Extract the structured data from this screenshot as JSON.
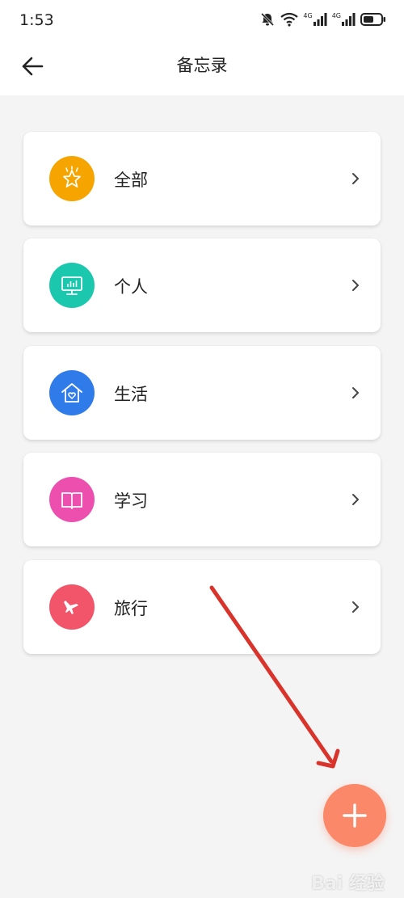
{
  "status_bar": {
    "time": "1:53",
    "signal_label_1": "4G",
    "signal_label_2": "4G",
    "icons": [
      "mute-bell-icon",
      "wifi-icon",
      "signal-icon",
      "signal-icon",
      "battery-icon"
    ]
  },
  "header": {
    "title": "备忘录",
    "back_icon": "arrow-left-icon"
  },
  "categories": [
    {
      "label": "全部",
      "icon": "star-icon",
      "color": "#f5a400"
    },
    {
      "label": "个人",
      "icon": "monitor-icon",
      "color": "#1cc8ad"
    },
    {
      "label": "生活",
      "icon": "home-icon",
      "color": "#2f7bea"
    },
    {
      "label": "学习",
      "icon": "book-icon",
      "color": "#ec4fae"
    },
    {
      "label": "旅行",
      "icon": "airplane-icon",
      "color": "#f2546a"
    }
  ],
  "fab": {
    "icon": "plus-icon",
    "color": "#fb8868"
  },
  "annotation": {
    "arrow_color": "#d9342b"
  },
  "watermark": "Bai 经验"
}
